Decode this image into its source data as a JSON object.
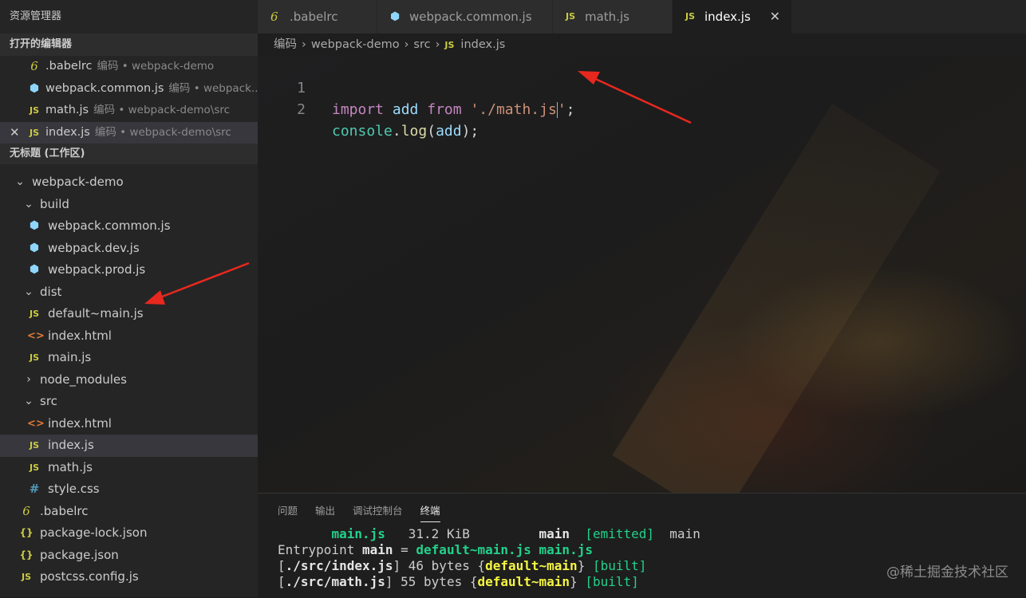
{
  "sidebar": {
    "title": "资源管理器",
    "open_editors_header": "打开的编辑器",
    "open_editors": [
      {
        "icon": "babel-icon",
        "icon_text": "6",
        "name": ".babelrc",
        "desc": "编码 • webpack-demo"
      },
      {
        "icon": "webpack-icon",
        "icon_text": "⬢",
        "name": "webpack.common.js",
        "desc": "编码 • webpack..."
      },
      {
        "icon": "js-icon",
        "icon_text": "JS",
        "name": "math.js",
        "desc": "编码 • webpack-demo\\src"
      },
      {
        "icon": "js-icon",
        "icon_text": "JS",
        "name": "index.js",
        "desc": "编码 • webpack-demo\\src",
        "close": "✕"
      }
    ],
    "workspace_header": "无标题 (工作区)",
    "tree": [
      {
        "label": "webpack-demo",
        "chev": "⌄"
      },
      {
        "label": "build",
        "chev": "⌄"
      },
      {
        "label": "webpack.common.js",
        "icon_text": "⬢"
      },
      {
        "label": "webpack.dev.js",
        "icon_text": "⬢"
      },
      {
        "label": "webpack.prod.js",
        "icon_text": "⬢"
      },
      {
        "label": "dist",
        "chev": "⌄"
      },
      {
        "label": "default~main.js",
        "icon_text": "JS"
      },
      {
        "label": "index.html",
        "icon_text": "<>"
      },
      {
        "label": "main.js",
        "icon_text": "JS"
      },
      {
        "label": "node_modules",
        "chev": "›"
      },
      {
        "label": "src",
        "chev": "⌄"
      },
      {
        "label": "index.html",
        "icon_text": "<>"
      },
      {
        "label": "index.js",
        "icon_text": "JS"
      },
      {
        "label": "math.js",
        "icon_text": "JS"
      },
      {
        "label": "style.css",
        "icon_text": "#"
      },
      {
        "label": ".babelrc",
        "icon_text": "6"
      },
      {
        "label": "package-lock.json",
        "icon_text": "{}"
      },
      {
        "label": "package.json",
        "icon_text": "{}"
      },
      {
        "label": "postcss.config.js",
        "icon_text": "JS"
      }
    ]
  },
  "tabs": [
    {
      "icon_text": "6",
      "label": ".babelrc"
    },
    {
      "icon_text": "⬢",
      "label": "webpack.common.js"
    },
    {
      "icon_text": "JS",
      "label": "math.js"
    },
    {
      "icon_text": "JS",
      "label": "index.js",
      "close": "✕"
    }
  ],
  "breadcrumb": {
    "parts": [
      "编码",
      "webpack-demo",
      "src"
    ],
    "file_icon": "JS",
    "file": "index.js",
    "sep": "›"
  },
  "editor": {
    "line_numbers": [
      "1",
      "2"
    ],
    "line1": {
      "kw": "import",
      "var": "add",
      "from": "from",
      "str": "'./math.js",
      "str_end": "'",
      "end": ";"
    },
    "line2": {
      "obj": "console",
      "dot": ".",
      "fn": "log",
      "open": "(",
      "var": "add",
      "close": ");"
    }
  },
  "panel": {
    "tabs": [
      "问题",
      "输出",
      "调试控制台",
      "终端"
    ],
    "active_tab": "终端",
    "terminal": {
      "l1": {
        "pad": "       ",
        "asset": "main.js",
        "size": "   31.2 KiB         ",
        "chunk": "main",
        "gap": "  ",
        "status": "[emitted]",
        "tail": "  main"
      },
      "l2": {
        "pre": "Entrypoint ",
        "name": "main",
        "eq": " = ",
        "files": "default~main.js main.js"
      },
      "l3": {
        "open": "[",
        "path": "./src/index.js",
        "mid": "] 46 bytes {",
        "chunk": "default~main",
        "mid2": "} ",
        "built": "[built]"
      },
      "l4": {
        "open": "[",
        "path": "./src/math.js",
        "mid": "] 55 bytes {",
        "chunk": "default~main",
        "mid2": "} ",
        "built": "[built]"
      }
    },
    "watermark": "@稀土掘金技术社区"
  },
  "colors": {
    "accent_arrow": "#e8281e",
    "js_yellow": "#cbcb41",
    "webpack_blue": "#8ed6fb"
  }
}
